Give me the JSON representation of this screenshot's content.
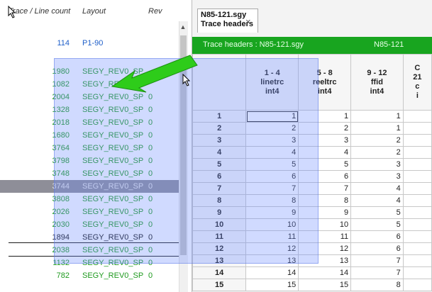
{
  "list": {
    "headers": {
      "count": "Trace / Line count",
      "layout": "Layout",
      "rev": "Rev"
    },
    "rows": [
      {
        "count": "114",
        "layout": "P1-90",
        "rev": "",
        "color": "blue"
      },
      {
        "count": "1980",
        "layout": "SEGY_REV0_SP",
        "rev": "",
        "color": "green"
      },
      {
        "count": "1082",
        "layout": "SEGY_REV0_SP",
        "rev": "",
        "color": "green"
      },
      {
        "count": "2004",
        "layout": "SEGY_REV0_SP",
        "rev": "0",
        "color": "green"
      },
      {
        "count": "1328",
        "layout": "SEGY_REV0_SP",
        "rev": "0",
        "color": "green"
      },
      {
        "count": "2018",
        "layout": "SEGY_REV0_SP",
        "rev": "0",
        "color": "green"
      },
      {
        "count": "1680",
        "layout": "SEGY_REV0_SP",
        "rev": "0",
        "color": "green"
      },
      {
        "count": "3764",
        "layout": "SEGY_REV0_SP",
        "rev": "0",
        "color": "green"
      },
      {
        "count": "3798",
        "layout": "SEGY_REV0_SP",
        "rev": "0",
        "color": "green"
      },
      {
        "count": "3748",
        "layout": "SEGY_REV0_SP",
        "rev": "0",
        "color": "green"
      },
      {
        "count": "3744",
        "layout": "SEGY_REV0_SP",
        "rev": "0",
        "color": "selected"
      },
      {
        "count": "3808",
        "layout": "SEGY_REV0_SP",
        "rev": "0",
        "color": "green"
      },
      {
        "count": "2026",
        "layout": "SEGY_REV0_SP",
        "rev": "0",
        "color": "green"
      },
      {
        "count": "2030",
        "layout": "SEGY_REV0_SP",
        "rev": "0",
        "color": "green"
      },
      {
        "count": "1894",
        "layout": "SEGY_REV0_SP",
        "rev": "0",
        "color": "dark"
      },
      {
        "count": "2038",
        "layout": "SEGY_REV0_SP",
        "rev": "0",
        "color": "green"
      },
      {
        "count": "1132",
        "layout": "SEGY_REV0_SP",
        "rev": "0",
        "color": "green"
      },
      {
        "count": "782",
        "layout": "SEGY_REV0_SP",
        "rev": "0",
        "color": "green"
      }
    ]
  },
  "tab": {
    "title_line1": "N85-121.sgy",
    "title_line2": "Trace headers",
    "close": "×"
  },
  "header_bar": {
    "label": "Trace headers : N85-121.sgy",
    "file": "N85-121"
  },
  "columns": [
    {
      "range": "1 - 4",
      "name": "linetrc",
      "type": "int4"
    },
    {
      "range": "5 - 8",
      "name": "reeltrc",
      "type": "int4"
    },
    {
      "range": "9 - 12",
      "name": "ffid",
      "type": "int4"
    },
    {
      "range": "21",
      "name": "c",
      "type": "i",
      "prefix": "C"
    }
  ],
  "table_rows": [
    {
      "n": "1",
      "a": "1",
      "b": "1",
      "c": "1",
      "d": ""
    },
    {
      "n": "2",
      "a": "2",
      "b": "2",
      "c": "1",
      "d": ""
    },
    {
      "n": "3",
      "a": "3",
      "b": "3",
      "c": "2",
      "d": ""
    },
    {
      "n": "4",
      "a": "4",
      "b": "4",
      "c": "2",
      "d": ""
    },
    {
      "n": "5",
      "a": "5",
      "b": "5",
      "c": "3",
      "d": ""
    },
    {
      "n": "6",
      "a": "6",
      "b": "6",
      "c": "3",
      "d": ""
    },
    {
      "n": "7",
      "a": "7",
      "b": "7",
      "c": "4",
      "d": ""
    },
    {
      "n": "8",
      "a": "8",
      "b": "8",
      "c": "4",
      "d": ""
    },
    {
      "n": "9",
      "a": "9",
      "b": "9",
      "c": "5",
      "d": ""
    },
    {
      "n": "10",
      "a": "10",
      "b": "10",
      "c": "5",
      "d": ""
    },
    {
      "n": "11",
      "a": "11",
      "b": "11",
      "c": "6",
      "d": ""
    },
    {
      "n": "12",
      "a": "12",
      "b": "12",
      "c": "6",
      "d": ""
    },
    {
      "n": "13",
      "a": "13",
      "b": "13",
      "c": "7",
      "d": ""
    },
    {
      "n": "14",
      "a": "14",
      "b": "14",
      "c": "7",
      "d": ""
    },
    {
      "n": "15",
      "a": "15",
      "b": "15",
      "c": "8",
      "d": ""
    }
  ],
  "colors": {
    "accent_green": "#18a51f",
    "row_green": "#1e9a1e",
    "link_blue": "#1f5fc9",
    "overlay": "#6e8cff",
    "selected_row": "#8e8e98"
  },
  "icons": {
    "arrow": "green-arrow-icon",
    "cursor": "mouse-pointer-icon",
    "scroll_up": "chevron-up-icon"
  }
}
